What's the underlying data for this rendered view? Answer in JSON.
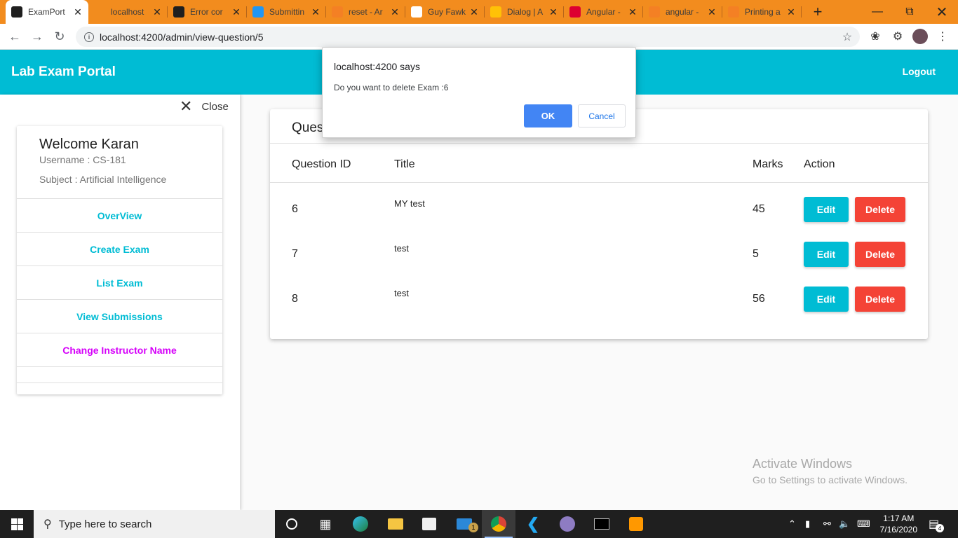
{
  "browser": {
    "tabs": [
      {
        "title": "ExamPort",
        "active": true,
        "favicon": "angular-icon",
        "fav_color": "#1f1f1f"
      },
      {
        "title": "localhost",
        "favicon": "phpmyadmin-icon",
        "fav_color": "#f28c1e"
      },
      {
        "title": "Error cor",
        "favicon": "github-icon",
        "fav_color": "#1f1f1f"
      },
      {
        "title": "Submittin",
        "favicon": "chat-icon",
        "fav_color": "#2196f3"
      },
      {
        "title": "reset - Ar",
        "favicon": "stackoverflow-icon",
        "fav_color": "#f48024"
      },
      {
        "title": "Guy Fawk",
        "favicon": "wikipedia-icon",
        "fav_color": "#ffffff"
      },
      {
        "title": "Dialog | A",
        "favicon": "material-icon",
        "fav_color": "#ffc107"
      },
      {
        "title": "Angular -",
        "favicon": "angular-icon",
        "fav_color": "#dd0031"
      },
      {
        "title": "angular -",
        "favicon": "stackoverflow-icon",
        "fav_color": "#f48024"
      },
      {
        "title": "Printing a",
        "favicon": "stackoverflow-icon",
        "fav_color": "#f48024"
      }
    ],
    "url": "localhost:4200/admin/view-question/5"
  },
  "app": {
    "brand": "Lab Exam Portal",
    "logout": "Logout",
    "accent": "#00bcd4"
  },
  "sidebar": {
    "close_label": "Close",
    "welcome": "Welcome Karan",
    "username": "Username : CS-181",
    "subject": "Subject : Artificial Intelligence",
    "menu": [
      "OverView",
      "Create Exam",
      "List Exam",
      "View Submissions",
      "Change Instructor Name"
    ]
  },
  "main": {
    "heading": "Ques",
    "columns": {
      "id": "Question ID",
      "title": "Title",
      "marks": "Marks",
      "action": "Action"
    },
    "rows": [
      {
        "id": "6",
        "title": "MY test",
        "marks": "45"
      },
      {
        "id": "7",
        "title": "test",
        "marks": "5"
      },
      {
        "id": "8",
        "title": "test",
        "marks": "56"
      }
    ],
    "edit_label": "Edit",
    "delete_label": "Delete"
  },
  "dialog": {
    "title": "localhost:4200 says",
    "message": "Do you want to delete Exam :6",
    "ok": "OK",
    "cancel": "Cancel"
  },
  "watermark": {
    "line1": "Activate Windows",
    "line2": "Go to Settings to activate Windows."
  },
  "taskbar": {
    "search_placeholder": "Type here to search",
    "time": "1:17 AM",
    "date": "7/16/2020",
    "mail_badge": "1",
    "notif_badge": "4"
  }
}
